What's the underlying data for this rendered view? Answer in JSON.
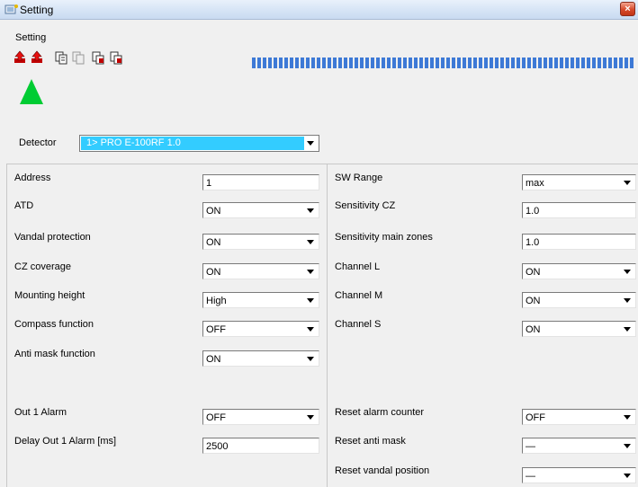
{
  "window": {
    "title": "Setting",
    "close_glyph": "×"
  },
  "menu": {
    "items": [
      {
        "label": "Setting"
      }
    ]
  },
  "toolbar": {
    "icons": [
      "upload-red-icon",
      "upload-red-icon",
      "copy-icon",
      "copy-disabled-icon",
      "paste-icon",
      "paste-icon"
    ]
  },
  "status": {
    "indicator_color": "#00cc33"
  },
  "detector": {
    "label": "Detector",
    "value": "1> PRO E-100RF 1.0",
    "highlight_color": "#33ccff"
  },
  "left_params": [
    {
      "label": "Address",
      "value": "1",
      "type": "text"
    },
    {
      "label": "ATD",
      "value": "ON",
      "type": "select"
    },
    {
      "label": "Vandal protection",
      "value": "ON",
      "type": "select"
    },
    {
      "label": "CZ coverage",
      "value": "ON",
      "type": "select"
    },
    {
      "label": "Mounting height",
      "value": "High",
      "type": "select"
    },
    {
      "label": "Compass function",
      "value": "OFF",
      "type": "select"
    },
    {
      "label": "Anti mask function",
      "value": "ON",
      "type": "select"
    },
    {
      "label": "Out 1 Alarm",
      "value": "OFF",
      "type": "select"
    },
    {
      "label": "Delay Out 1 Alarm [ms]",
      "value": "2500",
      "type": "text"
    }
  ],
  "right_params": [
    {
      "label": "SW Range",
      "value": "max",
      "type": "select"
    },
    {
      "label": "Sensitivity CZ",
      "value": "1.0",
      "type": "text"
    },
    {
      "label": "Sensitivity main zones",
      "value": "1.0",
      "type": "text"
    },
    {
      "label": "Channel L",
      "value": "ON",
      "type": "select"
    },
    {
      "label": "Channel M",
      "value": "ON",
      "type": "select"
    },
    {
      "label": "Channel S",
      "value": "ON",
      "type": "select"
    },
    {
      "label": "Reset alarm counter",
      "value": "OFF",
      "type": "select"
    },
    {
      "label": "Reset anti mask",
      "value": "—",
      "type": "select"
    },
    {
      "label": "Reset vandal position",
      "value": "—",
      "type": "select"
    }
  ]
}
